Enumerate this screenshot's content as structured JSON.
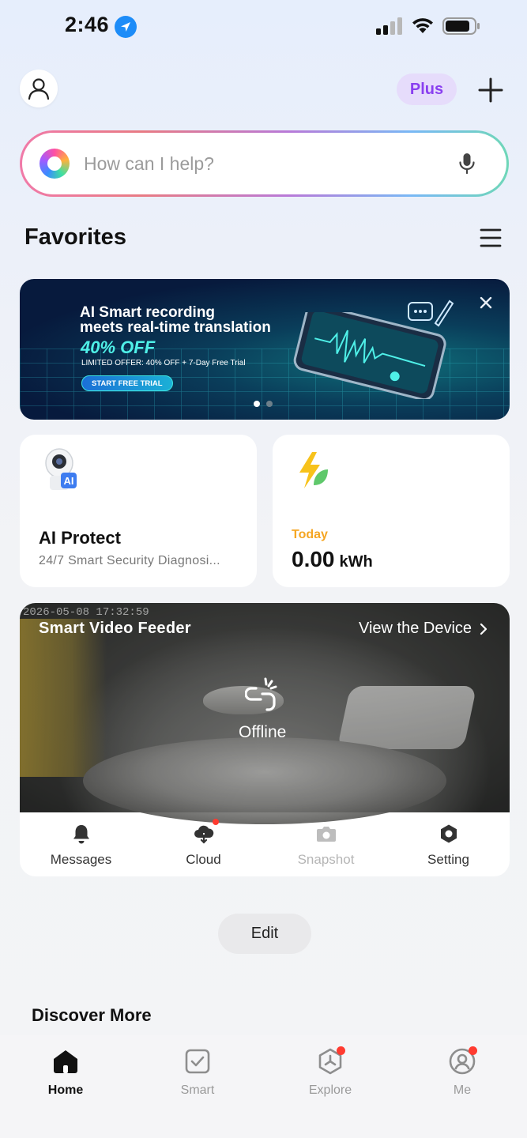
{
  "status_bar": {
    "time": "2:46"
  },
  "header": {
    "plan_badge": "Plus"
  },
  "search": {
    "placeholder": "How can I help?"
  },
  "favorites": {
    "title": "Favorites"
  },
  "banner": {
    "line1": "AI Smart recording",
    "line2": "meets real-time translation",
    "discount": "40% OFF",
    "offer": "LIMITED OFFER: 40% OFF + 7-Day Free Trial",
    "cta": "START FREE TRIAL",
    "page_count": 2,
    "active_page": 1
  },
  "ai_protect": {
    "title": "AI Protect",
    "subtitle": "24/7 Smart Security Diagnosi..."
  },
  "energy": {
    "label": "Today",
    "value": "0.00",
    "unit": "kWh"
  },
  "device": {
    "timestamp": "2026-05-08 17:32:59",
    "name": "Smart Video Feeder",
    "view_link": "View the Device",
    "status": "Offline",
    "actions": [
      {
        "label": "Messages",
        "icon": "bell-icon",
        "badge": false,
        "disabled": false
      },
      {
        "label": "Cloud",
        "icon": "cloud-icon",
        "badge": true,
        "disabled": false
      },
      {
        "label": "Snapshot",
        "icon": "camera-icon",
        "badge": false,
        "disabled": true
      },
      {
        "label": "Setting",
        "icon": "hexagon-settings-icon",
        "badge": false,
        "disabled": false
      }
    ]
  },
  "edit": {
    "label": "Edit"
  },
  "discover": {
    "title": "Discover More"
  },
  "tabbar": {
    "tabs": [
      {
        "label": "Home",
        "icon": "home-icon",
        "active": true,
        "badge": false
      },
      {
        "label": "Smart",
        "icon": "checkbox-icon",
        "active": false,
        "badge": false
      },
      {
        "label": "Explore",
        "icon": "explore-icon",
        "active": false,
        "badge": true
      },
      {
        "label": "Me",
        "icon": "profile-icon",
        "active": false,
        "badge": true
      }
    ]
  },
  "colors": {
    "accent_purple": "#8a3ff0",
    "energy_orange": "#f5a623",
    "badge_red": "#ff3b30"
  }
}
